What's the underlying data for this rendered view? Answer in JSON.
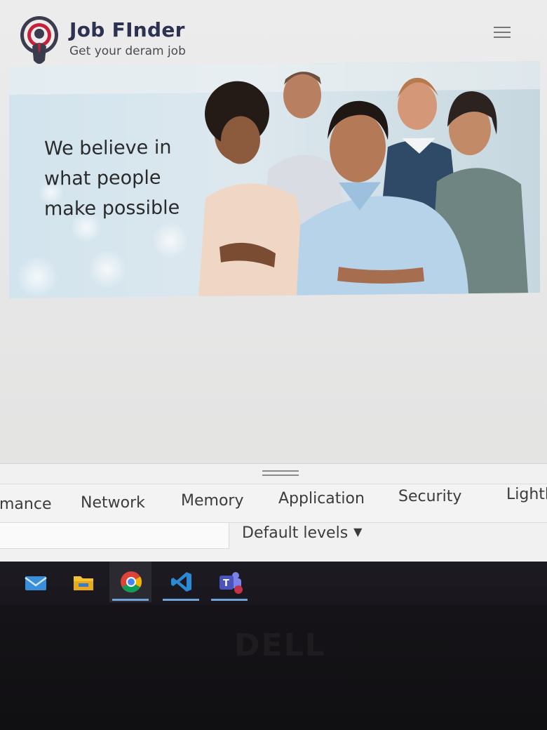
{
  "header": {
    "title": "Job FInder",
    "tagline": "Get your deram job",
    "logo_icon": "location-pin-person-icon",
    "menu_icon": "hamburger-menu-icon"
  },
  "hero": {
    "lines": [
      "We believe in",
      "what people",
      "make possible"
    ],
    "image": "group-of-smiling-professionals-photo"
  },
  "devtools": {
    "tabs": [
      "mance",
      "Network",
      "Memory",
      "Application",
      "Security",
      "Lightl"
    ],
    "levels_label": "Default levels",
    "levels_caret": "▼"
  },
  "taskbar": {
    "apps": [
      "mail-icon",
      "file-explorer-icon",
      "chrome-icon",
      "vscode-icon",
      "teams-icon"
    ]
  },
  "bezel": {
    "logo": "DELL"
  },
  "colors": {
    "brand": "#2d3152",
    "logo_red": "#c8203a",
    "taskbar": "#1d1b22",
    "active_underline": "#6fa3d6"
  }
}
